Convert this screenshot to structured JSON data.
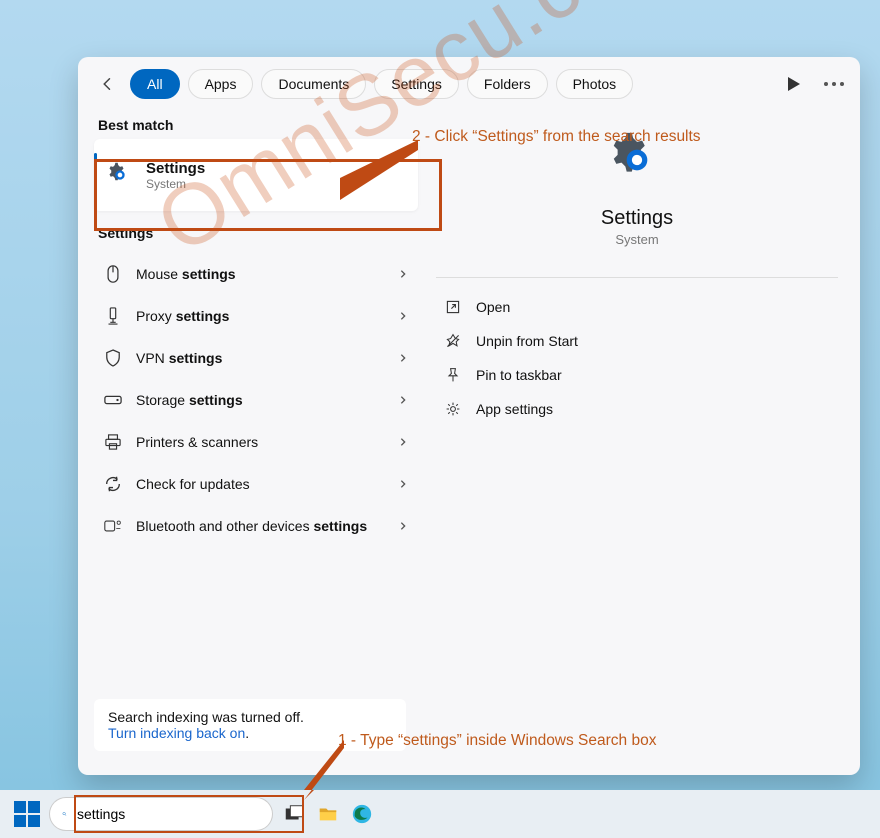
{
  "head": {
    "tabs": [
      "All",
      "Apps",
      "Documents",
      "Settings",
      "Folders",
      "Photos"
    ],
    "active": "All"
  },
  "bestMatch": {
    "heading": "Best match",
    "result": {
      "title": "Settings",
      "subtitle": "System"
    }
  },
  "settingsSection": {
    "heading": "Settings",
    "items": [
      {
        "icon": "mouse",
        "prefix": "Mouse ",
        "bold": "settings"
      },
      {
        "icon": "proxy",
        "prefix": "Proxy ",
        "bold": "settings"
      },
      {
        "icon": "vpn",
        "prefix": "VPN ",
        "bold": "settings"
      },
      {
        "icon": "storage",
        "prefix": "Storage ",
        "bold": "settings"
      },
      {
        "icon": "printer",
        "prefix": "Printers & scanners",
        "bold": ""
      },
      {
        "icon": "update",
        "prefix": "Check for updates",
        "bold": ""
      },
      {
        "icon": "bluetooth",
        "prefix": "Bluetooth and other devices ",
        "bold": "settings"
      }
    ]
  },
  "tip": {
    "line1": "Search indexing was turned off.",
    "link": "Turn indexing back on",
    "suffix": "."
  },
  "preview": {
    "title": "Settings",
    "subtitle": "System"
  },
  "actions": [
    {
      "icon": "open",
      "label": "Open"
    },
    {
      "icon": "unpin",
      "label": "Unpin from Start"
    },
    {
      "icon": "pin",
      "label": "Pin to taskbar"
    },
    {
      "icon": "appsettings",
      "label": "App settings"
    }
  ],
  "taskbar": {
    "searchValue": "settings"
  },
  "annotations": {
    "a1": "2 - Click “Settings” from the search results",
    "a2": "1 - Type “settings” inside Windows Search box"
  },
  "watermark": "OmniSecu.com"
}
